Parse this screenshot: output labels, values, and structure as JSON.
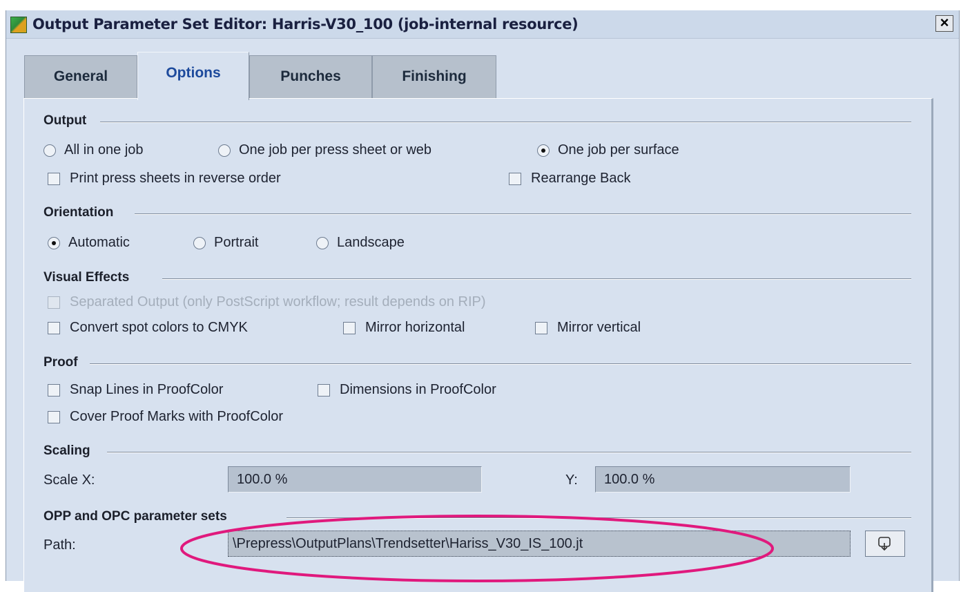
{
  "window": {
    "title": "Output Parameter Set Editor: Harris-V30_100 (job-internal resource)",
    "close_label": "×"
  },
  "tabs": [
    {
      "label": "General",
      "active": false
    },
    {
      "label": "Options",
      "active": true
    },
    {
      "label": "Punches",
      "active": false
    },
    {
      "label": "Finishing",
      "active": false
    }
  ],
  "output": {
    "title": "Output",
    "radios": [
      {
        "label": "All in one job",
        "checked": false
      },
      {
        "label": "One job per press sheet or web",
        "checked": false
      },
      {
        "label": "One job per surface",
        "checked": true
      }
    ],
    "reverse_order_label": "Print press sheets in reverse order",
    "rearrange_back_label": "Rearrange Back"
  },
  "orientation": {
    "title": "Orientation",
    "radios": [
      {
        "label": "Automatic",
        "checked": true
      },
      {
        "label": "Portrait",
        "checked": false
      },
      {
        "label": "Landscape",
        "checked": false
      }
    ]
  },
  "visual_effects": {
    "title": "Visual Effects",
    "separated_output_label": "Separated Output (only PostScript workflow; result depends on RIP)",
    "convert_spot_label": "Convert spot colors to CMYK",
    "mirror_horizontal_label": "Mirror horizontal",
    "mirror_vertical_label": "Mirror vertical"
  },
  "proof": {
    "title": "Proof",
    "snap_lines_label": "Snap Lines in ProofColor",
    "dimensions_label": "Dimensions in ProofColor",
    "cover_marks_label": "Cover Proof Marks with ProofColor"
  },
  "scaling": {
    "title": "Scaling",
    "scale_x_label": "Scale X:",
    "scale_x_value": "100.0 %",
    "y_label": "Y:",
    "y_value": "100.0 %"
  },
  "opp": {
    "title": "OPP and OPC parameter sets",
    "path_label": "Path:",
    "path_value": "\\Prepress\\OutputPlans\\Trendsetter\\Hariss_V30_IS_100.jt"
  },
  "colors": {
    "highlight": "#e0197d",
    "active_tab_text": "#1d4a9c",
    "panel_bg": "#d7e1ef"
  }
}
